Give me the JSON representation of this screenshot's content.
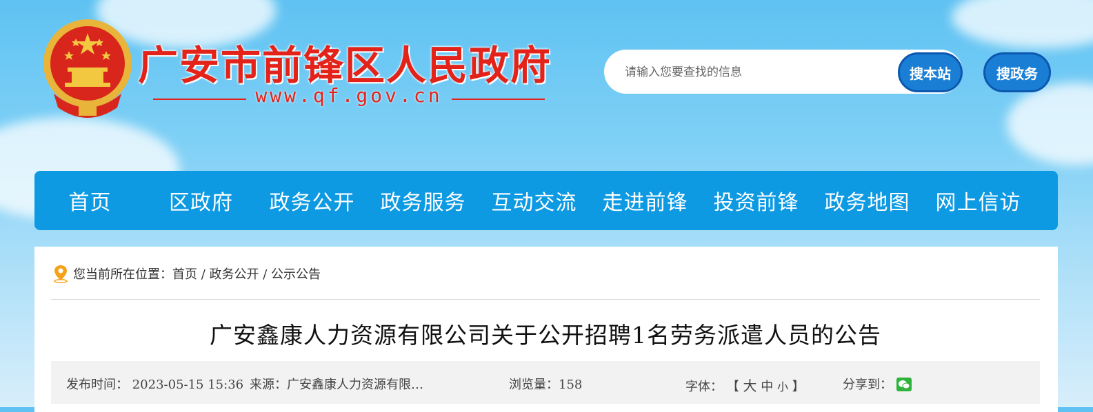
{
  "header": {
    "site_title": "广安市前锋区人民政府",
    "site_url": "www.qf.gov.cn",
    "search_placeholder": "请输入您要查找的信息",
    "search_site_label": "搜本站",
    "search_gov_label": "搜政务"
  },
  "nav": {
    "items": [
      "首页",
      "区政府",
      "政务公开",
      "政务服务",
      "互动交流",
      "走进前锋",
      "投资前锋",
      "政务地图",
      "网上信访"
    ]
  },
  "breadcrumb": {
    "prefix": "您当前所在位置：",
    "path": "首页 / 政务公开 / 公示公告"
  },
  "article": {
    "title": "广安鑫康人力资源有限公司关于公开招聘1名劳务派遣人员的公告",
    "publish_time": "发布时间：  2023-05-15 15:36",
    "source": "来源：广安鑫康人力资源有限…",
    "views": "浏览量：158",
    "font_label": "字体：",
    "font_sizes": {
      "open": "【",
      "large": "大",
      "medium": "中",
      "small": "小",
      "close": "】"
    },
    "share_label": "分享到："
  },
  "colors": {
    "brand_red": "#e3231a",
    "nav_blue": "#0d9ae3",
    "button_blue": "#1a7fd4"
  },
  "icons": {
    "location": "location-pin-icon",
    "share": "wechat-icon",
    "emblem": "national-emblem"
  }
}
